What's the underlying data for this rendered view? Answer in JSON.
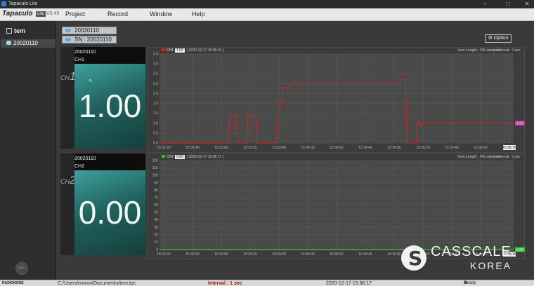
{
  "window": {
    "title": "Tapaculo Lite",
    "min": "–",
    "max": "□",
    "close": "✕"
  },
  "menubar": {
    "logo": "Tapaculo",
    "badge": "Lite",
    "version": "V3.49",
    "items": [
      "Project",
      "Record",
      "Window",
      "Help"
    ]
  },
  "sidebar": {
    "group": "tem",
    "device": "20020110",
    "rec_label": "REC"
  },
  "tags": {
    "device": "20020110",
    "serial": "SN : 20020110"
  },
  "option_button": "Option",
  "channels": [
    {
      "device": "20020110",
      "channel": "CH1",
      "ch_prefix": "CH",
      "ch_num": "1",
      "value": "1.00",
      "chart": {
        "legend_name": "CH1",
        "legend_value": "1.00",
        "timestamp": "[ 2020-12-17 15:36:16 ]",
        "view_length": "View Length : 240 samples",
        "interval": "Interval : 1 sec",
        "end_value": "1.00",
        "end_time": "15:36:16"
      }
    },
    {
      "device": "20020110",
      "channel": "CH2",
      "ch_prefix": "CH",
      "ch_num": "2",
      "value": "0.00",
      "chart": {
        "legend_name": "CH2",
        "legend_value": "0.00",
        "timestamp": "[ 2020-12-17 15:36:17 ]",
        "view_length": "View Length : 240 samples",
        "interval": "Interval : 1 sec",
        "end_value": "0.00",
        "end_time": ""
      }
    }
  ],
  "chart_data": [
    {
      "type": "line",
      "color": "#e02020",
      "ylim": [
        0,
        4.5
      ],
      "yticks": [
        "0.0",
        "0.5",
        "1.0",
        "1.5",
        "2.0",
        "2.5",
        "3.0",
        "3.5",
        "4.0",
        "4.5"
      ],
      "xticks": [
        "15:32:20",
        "15:32:40",
        "15:33:00",
        "15:33:20",
        "15:33:40",
        "15:34:00",
        "15:34:20",
        "15:34:40",
        "15:35:00",
        "15:35:20",
        "15:35:40",
        "15:36:00",
        "15:36:16"
      ],
      "xlim": [
        0,
        236
      ],
      "series": [
        {
          "name": "CH1",
          "x": [
            0,
            46,
            47,
            51,
            52,
            58,
            59,
            64,
            65,
            78,
            79,
            81,
            82,
            86,
            87,
            159,
            160,
            164,
            165,
            171,
            172,
            174,
            175,
            236
          ],
          "y": [
            0,
            0,
            1.4,
            1.4,
            0,
            0,
            1.4,
            1.4,
            0,
            0,
            1.8,
            1.8,
            2.8,
            2.8,
            3.0,
            3.0,
            3.2,
            3.2,
            0,
            0,
            1.2,
            0.8,
            1.0,
            1.0
          ]
        }
      ]
    },
    {
      "type": "line",
      "color": "#2fbf3a",
      "ylim": [
        0,
        120
      ],
      "yticks": [
        "0",
        "10",
        "20",
        "30",
        "40",
        "50",
        "60",
        "70",
        "80",
        "90",
        "100",
        "110",
        "120"
      ],
      "xticks": [
        "15:32:20",
        "15:32:40",
        "15:33:00",
        "15:33:20",
        "15:33:40",
        "15:34:00",
        "15:34:20",
        "15:34:40",
        "15:35:00",
        "15:35:20",
        "15:35:40",
        "15:36:00",
        "15:36:16"
      ],
      "xlim": [
        0,
        236
      ],
      "series": [
        {
          "name": "CH2",
          "x": [
            0,
            236
          ],
          "y": [
            0,
            0
          ]
        }
      ]
    }
  ],
  "statusbar": {
    "brand": "RADIONODE",
    "path": "C:/Users/morori/Documents/tem.tpc",
    "interval": "Interval : 1 sec",
    "datetime": "2020-12-17 15:36:17",
    "status": "Ready"
  },
  "watermark": {
    "line1": "CASSCALE",
    "line2": "KOREA"
  }
}
